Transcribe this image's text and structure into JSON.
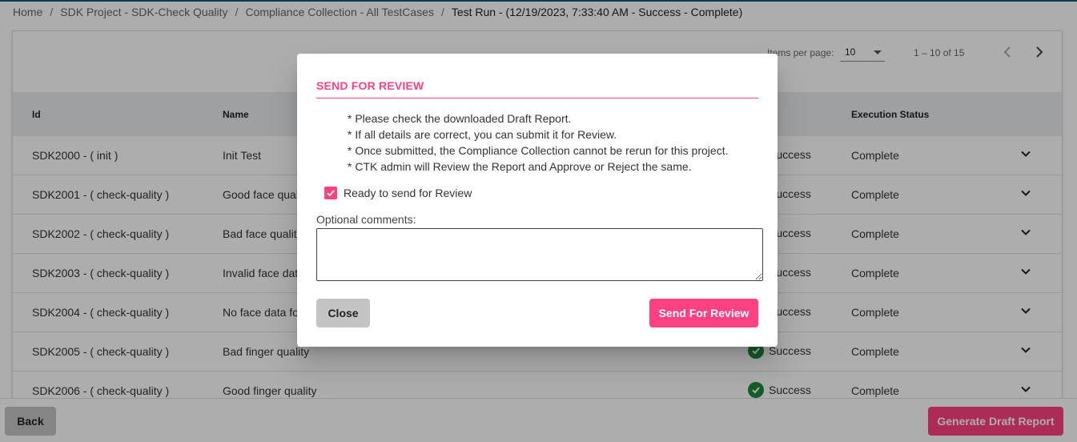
{
  "breadcrumb": [
    {
      "label": "Home"
    },
    {
      "label": "SDK Project - SDK-Check Quality"
    },
    {
      "label": "Compliance Collection - All TestCases"
    },
    {
      "label": "Test Run - (12/19/2023, 7:33:40 AM - Success - Complete)"
    }
  ],
  "paginator": {
    "items_per_page_label": "Items per page:",
    "items_per_page_value": "10",
    "range_label": "1 – 10 of 15",
    "prev_icon": "chevron-left-icon",
    "next_icon": "chevron-right-icon"
  },
  "table": {
    "headers": {
      "id": "Id",
      "name": "Name",
      "exec": "Execution Status"
    },
    "rows": [
      {
        "id": "SDK2000 - ( init )",
        "name": "Init Test",
        "result": "Success",
        "exec": "Complete"
      },
      {
        "id": "SDK2001 - ( check-quality )",
        "name": "Good face qual",
        "result": "Success",
        "exec": "Complete"
      },
      {
        "id": "SDK2002 - ( check-quality )",
        "name": "Bad face qualit",
        "result": "Success",
        "exec": "Complete"
      },
      {
        "id": "SDK2003 - ( check-quality )",
        "name": "Invalid face dat",
        "result": "Success",
        "exec": "Complete"
      },
      {
        "id": "SDK2004 - ( check-quality )",
        "name": "No face data fo",
        "result": "Success",
        "exec": "Complete"
      },
      {
        "id": "SDK2005 - ( check-quality )",
        "name": "Bad finger quality",
        "result": "Success",
        "exec": "Complete"
      },
      {
        "id": "SDK2006 - ( check-quality )",
        "name": "Good finger quality",
        "result": "Success",
        "exec": "Complete"
      }
    ]
  },
  "footer": {
    "back_label": "Back",
    "generate_label": "Generate Draft Report"
  },
  "dialog": {
    "title": "SEND FOR REVIEW",
    "notes": [
      "* Please check the downloaded Draft Report.",
      "* If all details are correct, you can submit it for Review.",
      "* Once submitted, the Compliance Collection cannot be rerun for this project.",
      "* CTK admin will Review the Report and Approve or Reject the same."
    ],
    "checkbox_label": "Ready to send for Review",
    "checkbox_checked": true,
    "comments_label": "Optional comments:",
    "comments_value": "",
    "close_label": "Close",
    "send_label": "Send For Review"
  },
  "colors": {
    "accent": "#ff4081",
    "success": "#1e8a3a",
    "header_bg": "#e9ecef"
  }
}
